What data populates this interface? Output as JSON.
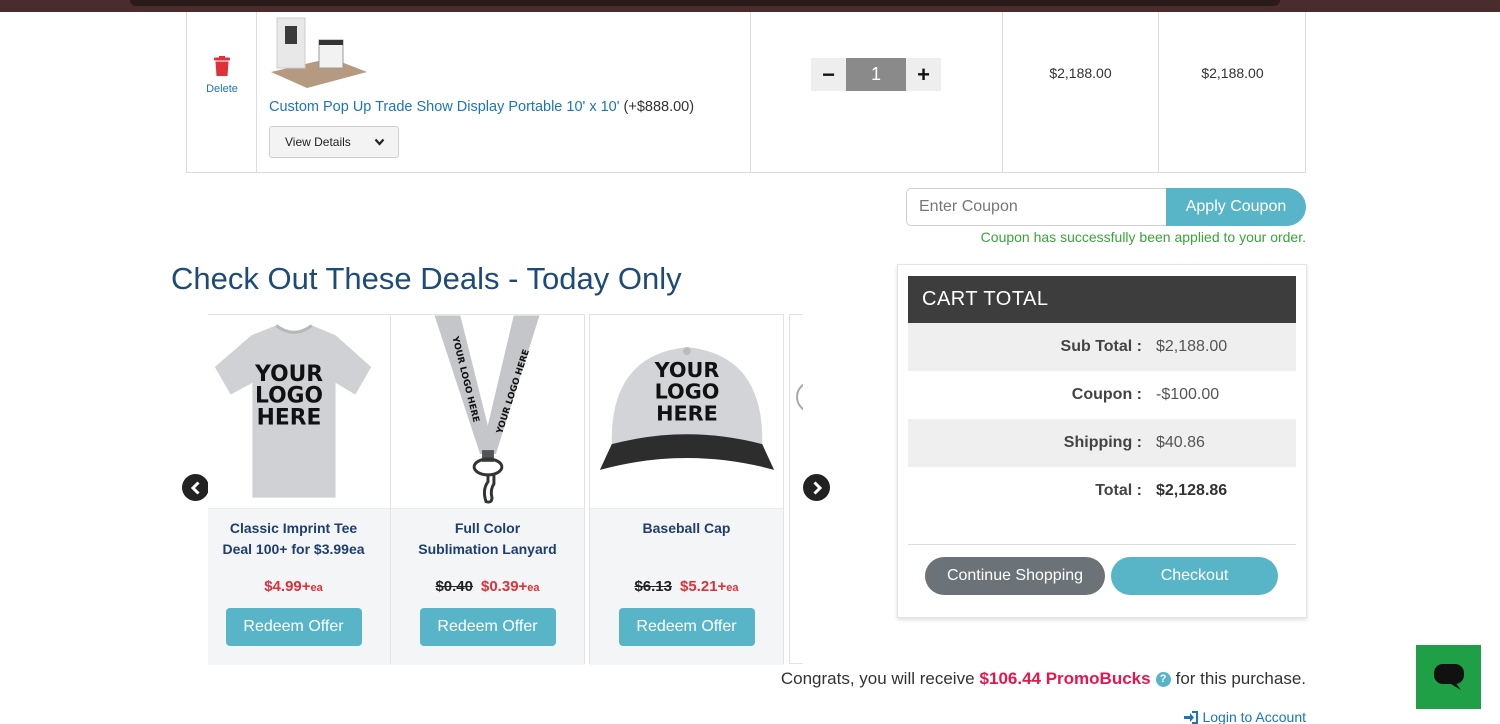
{
  "cart": {
    "delete_label": "Delete",
    "product_name": "Custom Pop Up Trade Show Display Portable 10' x 10'",
    "product_extra": "(+$888.00)",
    "view_details_label": "View Details",
    "quantity": "1",
    "unit_price": "$2,188.00",
    "line_total": "$2,188.00",
    "minus_label": "−",
    "plus_label": "+"
  },
  "coupon": {
    "placeholder": "Enter Coupon",
    "apply_label": "Apply Coupon",
    "success_message": "Coupon has successfully been applied to your order."
  },
  "deals": {
    "title": "Check Out These Deals - Today Only",
    "items": [
      {
        "image_text": [
          "YOUR",
          "LOGO",
          "HERE"
        ],
        "title_line1": "Classic Imprint Tee",
        "title_line2": "Deal 100+ for $3.99ea",
        "old_price": "",
        "price": "$4.99+",
        "unit": "ea",
        "button": "Redeem Offer"
      },
      {
        "image_text": [
          "YOUR LOGO HERE",
          "YOUR LOGO HERE"
        ],
        "title_line1": "Full Color",
        "title_line2": "Sublimation Lanyard",
        "old_price": "$0.40",
        "price": "$0.39+",
        "unit": "ea",
        "button": "Redeem Offer"
      },
      {
        "image_text": [
          "YOUR",
          "LOGO",
          "HERE"
        ],
        "title_line1": "Baseball Cap",
        "title_line2": "",
        "old_price": "$6.13",
        "price": "$5.21+",
        "unit": "ea",
        "button": "Redeem Offer"
      }
    ]
  },
  "cart_total": {
    "header": "CART  TOTAL",
    "rows": [
      {
        "label": "Sub Total :",
        "value": "$2,188.00"
      },
      {
        "label": "Coupon :",
        "value": "-$100.00"
      },
      {
        "label": "Shipping :",
        "value": "$40.86"
      },
      {
        "label": "Total :",
        "value": "$2,128.86"
      }
    ],
    "continue_label": "Continue Shopping",
    "checkout_label": "Checkout"
  },
  "promo": {
    "prefix": "Congrats, you will receive",
    "amount": "$106.44 PromoBucks",
    "help_glyph": "?",
    "suffix": "for this purchase."
  },
  "login_label": "Login to Account",
  "colors": {
    "accent": "#58b5c7",
    "link": "#1b75bc",
    "sale_red": "#e0303a",
    "promo_pink": "#e3174e",
    "success_green": "#3aa43a",
    "chat_green": "#1fa046"
  }
}
